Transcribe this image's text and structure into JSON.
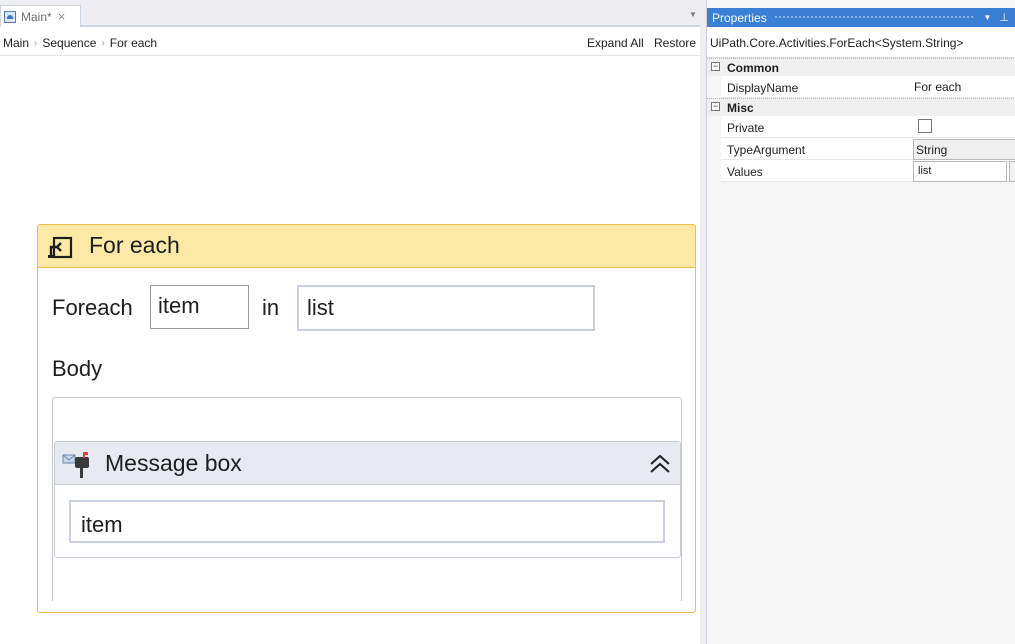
{
  "tab": {
    "label": "Main*",
    "close": "×"
  },
  "breadcrumb": {
    "items": [
      "Main",
      "Sequence",
      "For each"
    ],
    "separator": "›"
  },
  "toolbar": {
    "expand_all": "Expand All",
    "restore": "Restore"
  },
  "foreach_activity": {
    "title": "For each",
    "foreach_label": "Foreach",
    "item_variable": "item",
    "in_label": "in",
    "values_expression": "list",
    "body_label": "Body"
  },
  "message_box_activity": {
    "title": "Message box",
    "text_expression": "item"
  },
  "properties": {
    "title": "Properties",
    "type_name": "UiPath.Core.Activities.ForEach<System.String>",
    "categories": [
      {
        "label": "Common",
        "toggle": "⊟"
      },
      {
        "label": "Misc",
        "toggle": "⊟"
      }
    ],
    "display_name": {
      "name": "DisplayName",
      "value": "For each"
    },
    "private": {
      "name": "Private",
      "checked": false
    },
    "type_argument": {
      "name": "TypeArgument",
      "value": "String"
    },
    "values": {
      "name": "Values",
      "value": "list",
      "button": "..."
    }
  },
  "colors": {
    "foreach_header": "#fde9a6",
    "foreach_border": "#e6bf4e",
    "msgbox_header": "#e7eaf0",
    "props_titlebar": "#3b7fd4"
  }
}
